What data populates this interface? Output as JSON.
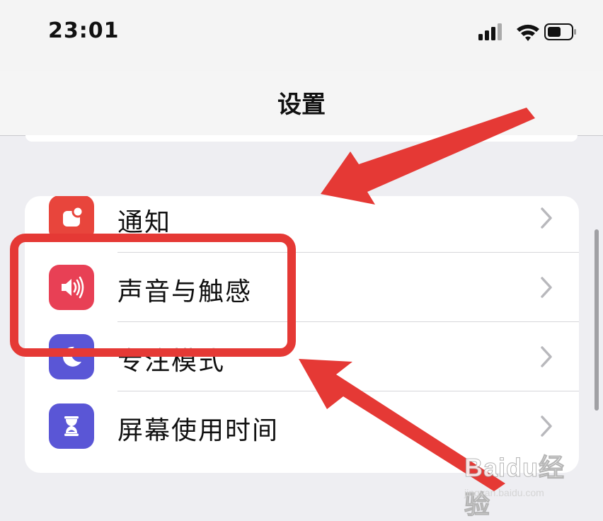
{
  "status_bar": {
    "time": "23:01",
    "icons": [
      "signal-icon",
      "wifi-icon",
      "battery-icon"
    ]
  },
  "nav": {
    "title": "设置"
  },
  "settings": {
    "items": [
      {
        "label": "通知",
        "icon": "bell-icon",
        "color": "#e8453c"
      },
      {
        "label": "声音与触感",
        "icon": "speaker-icon",
        "color": "#e84055"
      },
      {
        "label": "专注模式",
        "icon": "moon-icon",
        "color": "#5a56d6"
      },
      {
        "label": "屏幕使用时间",
        "icon": "hourglass-icon",
        "color": "#5a56d6"
      }
    ]
  },
  "annotations": {
    "color": "#e53935",
    "highlighted_item": "声音与触感"
  },
  "watermark": {
    "brand": "Baidu经验",
    "site": "jingyan.baidu.com"
  }
}
